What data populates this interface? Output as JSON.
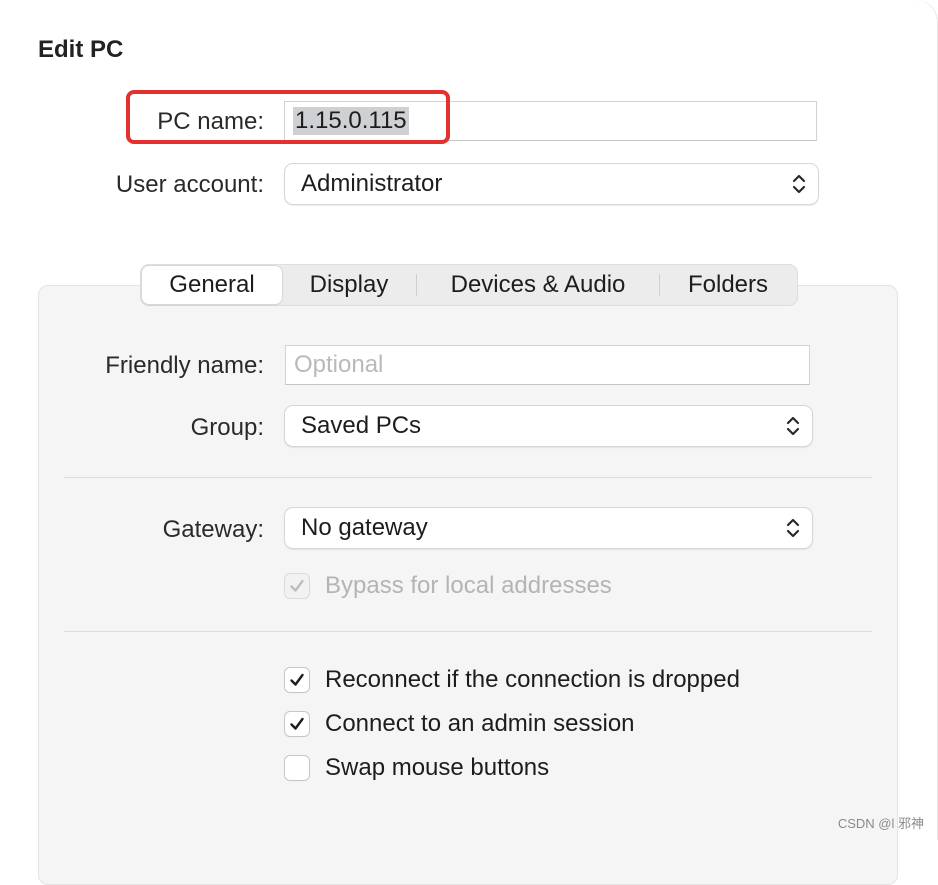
{
  "dialog": {
    "title": "Edit PC"
  },
  "pc_name": {
    "label": "PC name:",
    "value": "1.15.0.115"
  },
  "user_account": {
    "label": "User account:",
    "value": "Administrator"
  },
  "tabs": [
    {
      "label": "General",
      "active": true
    },
    {
      "label": "Display",
      "active": false
    },
    {
      "label": "Devices & Audio",
      "active": false
    },
    {
      "label": "Folders",
      "active": false
    }
  ],
  "general": {
    "friendly_name": {
      "label": "Friendly name:",
      "value": "",
      "placeholder": "Optional"
    },
    "group": {
      "label": "Group:",
      "value": "Saved PCs"
    },
    "gateway": {
      "label": "Gateway:",
      "value": "No gateway"
    },
    "bypass": {
      "label": "Bypass for local addresses",
      "checked": true,
      "enabled": false
    },
    "reconnect": {
      "label": "Reconnect if the connection is dropped",
      "checked": true
    },
    "admin_session": {
      "label": "Connect to an admin session",
      "checked": true
    },
    "swap_mouse": {
      "label": "Swap mouse buttons",
      "checked": false
    }
  },
  "annotation": {
    "highlight_color": "#e5312d"
  },
  "watermark": "CSDN @l 邪神",
  "icons": {
    "popup": "chevron-up-down-icon",
    "check": "checkmark-icon"
  }
}
